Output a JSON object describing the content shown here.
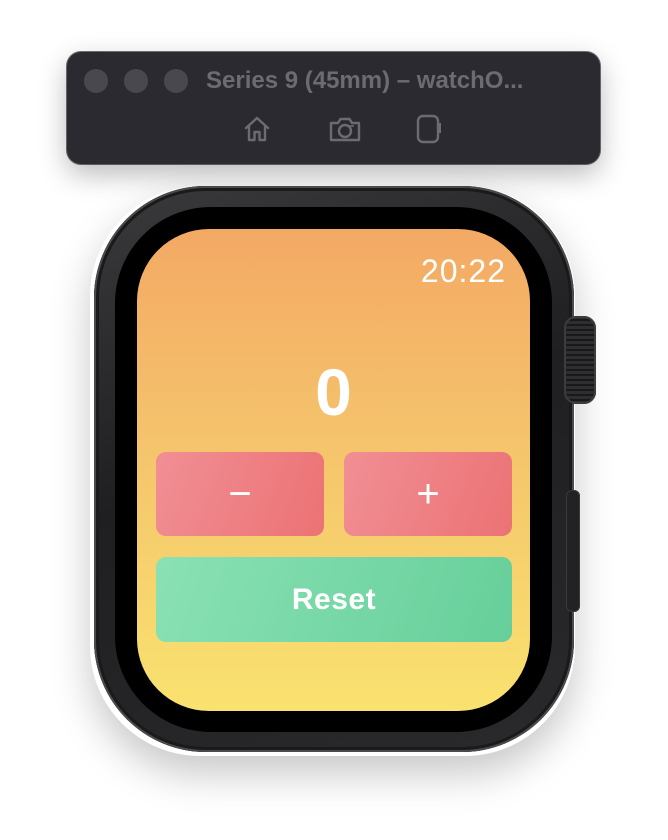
{
  "simulator": {
    "title": "Series 9 (45mm) – watchO...",
    "toolbar": {
      "home_icon": "home-icon",
      "screenshot_icon": "camera-icon",
      "rotate_icon": "rotate-device-icon"
    }
  },
  "watch": {
    "time": "20:22",
    "counter_value": "0",
    "decrement_label": "−",
    "increment_label": "+",
    "reset_label": "Reset"
  },
  "colors": {
    "screen_top": "#f3a964",
    "screen_bottom": "#f9e26f",
    "counter_button": "#ee7f84",
    "reset_button": "#76d8a6",
    "toolbar_bg": "#2c2a31"
  }
}
